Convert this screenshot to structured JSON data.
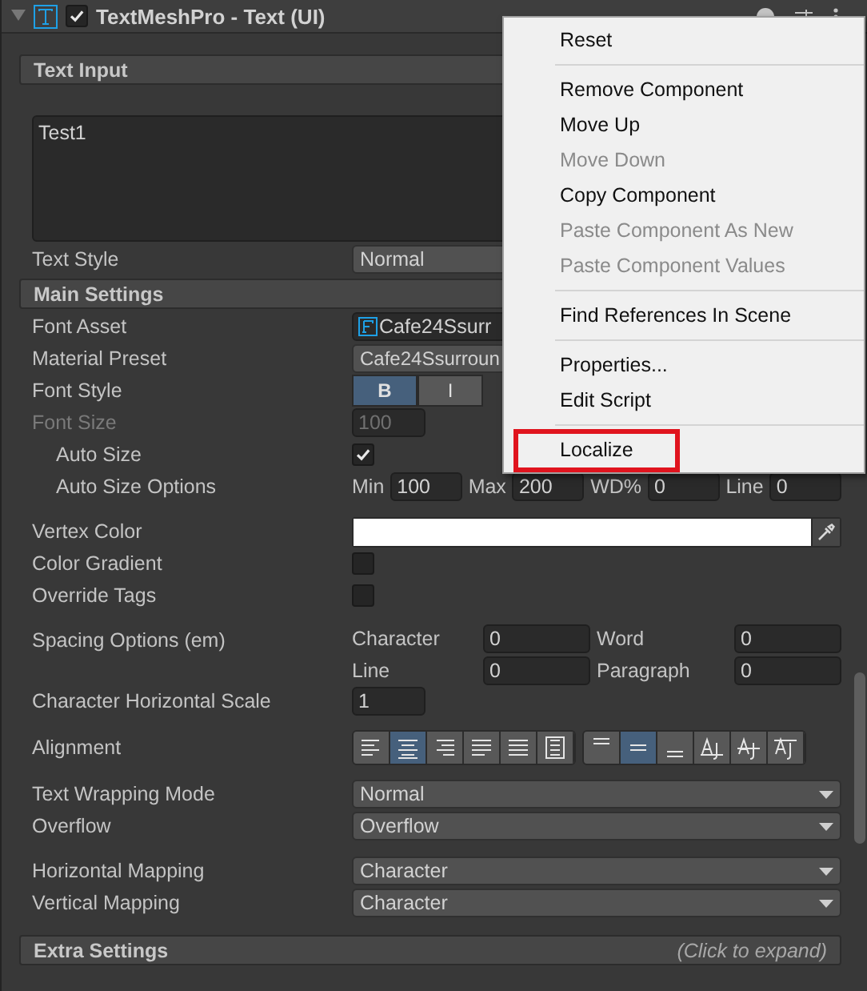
{
  "header": {
    "title": "TextMeshPro - Text (UI)",
    "enabled": true,
    "expanded": true
  },
  "text_input": {
    "title": "Text Input",
    "value": "Test1"
  },
  "text_style": {
    "label": "Text Style",
    "value": "Normal"
  },
  "main_settings": {
    "title": "Main Settings",
    "groups": [
      [
        {
          "kind": "object",
          "label": "Font Asset",
          "value": "Cafe24Ssurr"
        },
        {
          "kind": "preset",
          "label": "Material Preset",
          "value": "Cafe24Ssurroun"
        },
        {
          "kind": "toggles",
          "label": "Font Style",
          "buttons": [
            {
              "label": "B",
              "selected": true
            },
            {
              "label": "I",
              "selected": false
            }
          ]
        },
        {
          "kind": "number",
          "label": "Font Size",
          "value": "100",
          "disabled": true,
          "children": [
            {
              "kind": "checkbox",
              "label": "Auto Size",
              "checked": true
            },
            {
              "kind": "fields",
              "label": "Auto Size Options",
              "fields": [
                {
                  "label": "Min",
                  "value": "100"
                },
                {
                  "label": "Max",
                  "value": "200"
                },
                {
                  "label": "WD%",
                  "value": "0"
                },
                {
                  "label": "Line",
                  "value": "0"
                }
              ]
            }
          ]
        }
      ],
      [
        {
          "kind": "color",
          "label": "Vertex Color",
          "color": "#ffffff"
        },
        {
          "kind": "checkbox",
          "label": "Color Gradient",
          "checked": false
        },
        {
          "kind": "checkbox",
          "label": "Override Tags",
          "checked": false
        }
      ],
      [
        {
          "kind": "grid",
          "label": "Spacing Options (em)",
          "fields": [
            {
              "label": "Character",
              "value": "0"
            },
            {
              "label": "Word",
              "value": "0"
            },
            {
              "label": "Line",
              "value": "0"
            },
            {
              "label": "Paragraph",
              "value": "0"
            }
          ]
        },
        {
          "kind": "number",
          "label": "Character Horizontal Scale",
          "value": "1",
          "disabled": false
        }
      ],
      [
        {
          "kind": "alignment",
          "label": "Alignment",
          "groups": [
            [
              {
                "kind": "left",
                "selected": false
              },
              {
                "kind": "center",
                "selected": true
              },
              {
                "kind": "right",
                "selected": false
              },
              {
                "kind": "justified",
                "selected": false
              },
              {
                "kind": "flush",
                "selected": false
              },
              {
                "kind": "geometry",
                "selected": false
              }
            ],
            [
              {
                "kind": "top",
                "selected": false
              },
              {
                "kind": "middle",
                "selected": true
              },
              {
                "kind": "bottom",
                "selected": false
              },
              {
                "kind": "baseline",
                "selected": false
              },
              {
                "kind": "midline",
                "selected": false
              },
              {
                "kind": "capline",
                "selected": false
              }
            ]
          ]
        }
      ],
      [
        {
          "kind": "dropdown",
          "label": "Text Wrapping Mode",
          "value": "Normal"
        },
        {
          "kind": "dropdown",
          "label": "Overflow",
          "value": "Overflow"
        }
      ],
      [
        {
          "kind": "dropdown",
          "label": "Horizontal Mapping",
          "value": "Character"
        },
        {
          "kind": "dropdown",
          "label": "Vertical Mapping",
          "value": "Character"
        }
      ]
    ]
  },
  "extra_settings": {
    "title": "Extra Settings",
    "hint": "(Click to expand)"
  },
  "context_menu": {
    "groups": [
      [
        {
          "label": "Reset",
          "disabled": false,
          "outlined": false
        }
      ],
      [
        {
          "label": "Remove Component",
          "disabled": false,
          "outlined": false
        },
        {
          "label": "Move Up",
          "disabled": false,
          "outlined": false
        },
        {
          "label": "Move Down",
          "disabled": true,
          "outlined": false
        },
        {
          "label": "Copy Component",
          "disabled": false,
          "outlined": false
        },
        {
          "label": "Paste Component As New",
          "disabled": true,
          "outlined": false
        },
        {
          "label": "Paste Component Values",
          "disabled": true,
          "outlined": false
        }
      ],
      [
        {
          "label": "Find References In Scene",
          "disabled": false,
          "outlined": false
        }
      ],
      [
        {
          "label": "Properties...",
          "disabled": false,
          "outlined": false
        },
        {
          "label": "Edit Script",
          "disabled": false,
          "outlined": false
        }
      ],
      [
        {
          "label": "Localize",
          "disabled": false,
          "outlined": true
        }
      ]
    ]
  }
}
